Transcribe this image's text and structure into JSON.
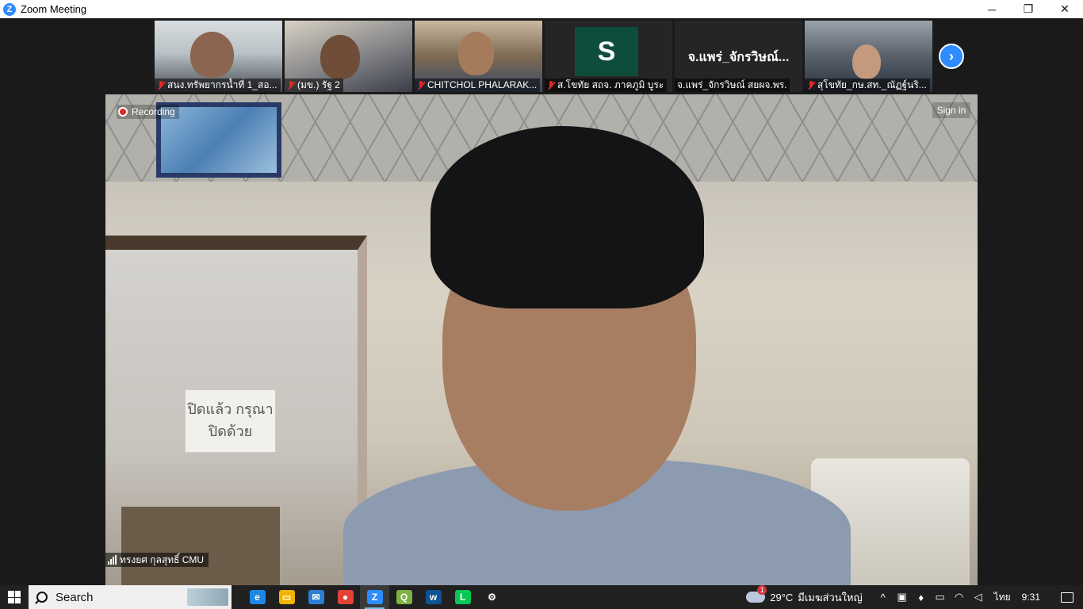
{
  "window": {
    "title": "Zoom Meeting",
    "app_icon": "zoom-icon",
    "minimize": "─",
    "restore": "❐",
    "close": "✕"
  },
  "gallery": [
    {
      "name": "สนง.ทรัพยากรน้ำที่ 1_สอ...",
      "muted": true
    },
    {
      "name": "(มข.) รัฐ 2",
      "muted": true
    },
    {
      "name": "CHITCHOL PHALARAK...",
      "muted": true
    },
    {
      "name": "ส.โขทัย สถจ. ภาคภูมิ บูระ",
      "muted": true,
      "avatar_letter": "S"
    },
    {
      "name": "จ.แพร่_จักรวิษณ์ สยผจ.พร.",
      "muted": false,
      "display_name": "จ.แพร่_จักรวิษณ์..."
    },
    {
      "name": "สุโขทัย_กษ.สท._ณัฏฐ์นริ...",
      "muted": true
    }
  ],
  "next_button": "›",
  "main": {
    "recording_label": "Recording",
    "signin_label": "Sign in",
    "speaker_name": "ทรงยศ กุลสุทธิ์ CMU",
    "sign_text": "ปิดแล้ว กรุณาปิดด้วย"
  },
  "taskbar": {
    "search_label": "Search",
    "apps": [
      {
        "name": "edge-icon",
        "color": "#1e88e5"
      },
      {
        "name": "file-explorer-icon",
        "color": "#f2b400"
      },
      {
        "name": "mail-icon",
        "color": "#2a7fd4"
      },
      {
        "name": "chrome-icon",
        "color": "#e34234"
      },
      {
        "name": "zoom-icon",
        "color": "#2d8cff",
        "active": true
      },
      {
        "name": "qgis-icon",
        "color": "#7cb342"
      },
      {
        "name": "webex-icon",
        "color": "#0b5394"
      },
      {
        "name": "line-icon",
        "color": "#06c755"
      },
      {
        "name": "settings-icon",
        "color": "#202020"
      }
    ],
    "weather_badge": "1",
    "temperature": "29°C",
    "weather_text": "มีเมฆส่วนใหญ่",
    "language": "ไทย",
    "time": "9:31"
  }
}
